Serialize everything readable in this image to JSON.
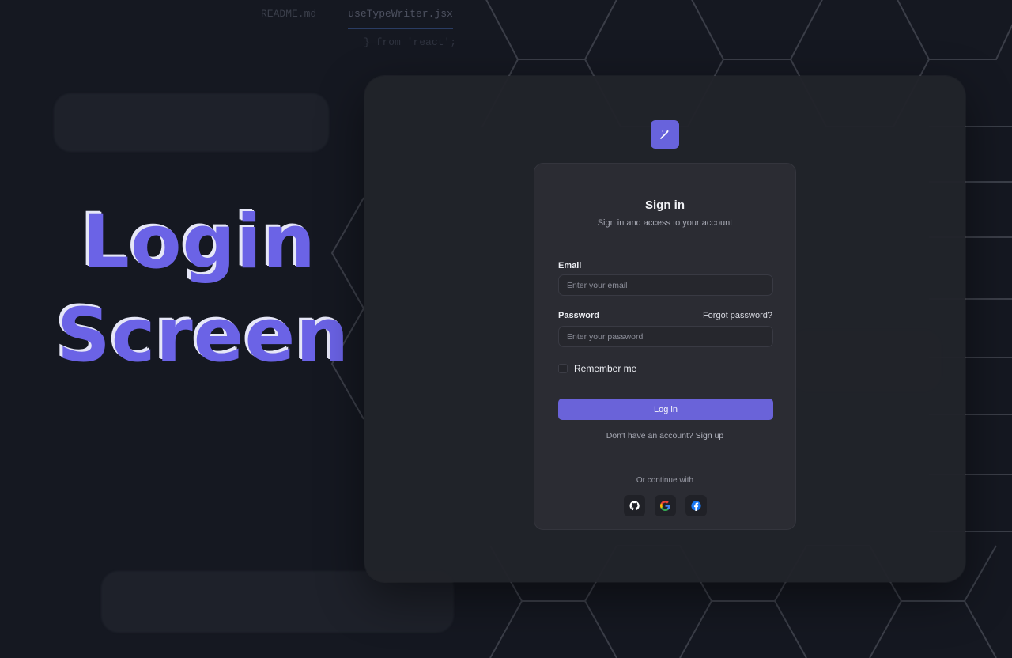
{
  "hero": {
    "line1": "Login",
    "line2": "Screen"
  },
  "background": {
    "editor_tabs": [
      "README.md",
      "useTypeWriter.jsx"
    ],
    "code_snippet": "} from 'react';"
  },
  "logo": {
    "icon": "wand-icon",
    "color": "#6863dc"
  },
  "signin": {
    "title": "Sign in",
    "subtitle": "Sign in and access to your account",
    "email_label": "Email",
    "email_placeholder": "Enter your email",
    "password_label": "Password",
    "forgot_label": "Forgot password?",
    "password_placeholder": "Enter your password",
    "remember_label": "Remember me",
    "login_button": "Log in",
    "signup_prompt": "Don't have an account?",
    "signup_link": "Sign up",
    "continue_label": "Or continue with",
    "providers": [
      "github-icon",
      "google-icon",
      "facebook-icon"
    ]
  },
  "colors": {
    "accent": "#6a63d9",
    "background": "#151821",
    "panel": "#21232a",
    "card": "#2b2c33"
  }
}
